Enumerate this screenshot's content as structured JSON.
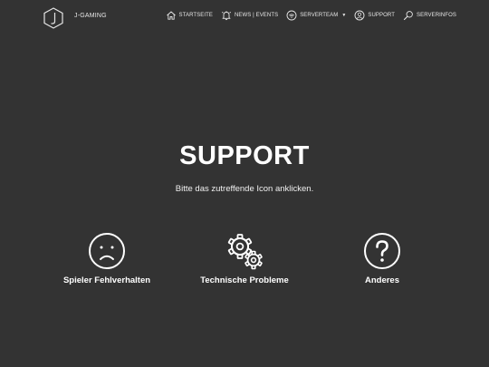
{
  "header": {
    "brand": "J-GAMING",
    "nav": [
      {
        "label": "STARTSEITE",
        "icon": "home-icon"
      },
      {
        "label": "NEWS | EVENTS",
        "icon": "bell-icon"
      },
      {
        "label": "SERVERTEAM",
        "icon": "wifi-badge-icon",
        "dropdown": true
      },
      {
        "label": "SUPPORT",
        "icon": "user-circle-icon"
      },
      {
        "label": "SERVERINFOS",
        "icon": "search-icon"
      }
    ]
  },
  "hero": {
    "title": "SUPPORT",
    "subtitle": "Bitte das zutreffende Icon anklicken."
  },
  "options": [
    {
      "label": "Spieler Fehlverhalten",
      "icon": "sad-face-icon"
    },
    {
      "label": "Technische Probleme",
      "icon": "gears-icon"
    },
    {
      "label": "Anderes",
      "icon": "question-mark-icon"
    }
  ],
  "colors": {
    "background": "#333333",
    "text": "#ffffff"
  }
}
